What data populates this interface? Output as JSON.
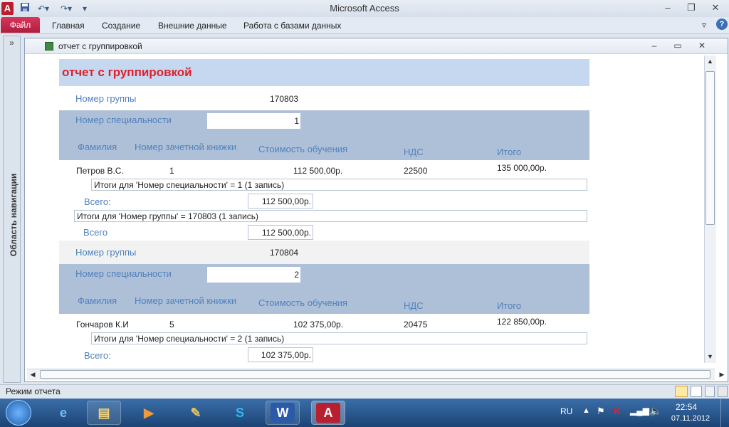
{
  "window": {
    "title": "Microsoft Access",
    "app_letter": "A",
    "minimize": "–",
    "maximize": "❐",
    "close": "✕"
  },
  "quick_access": {
    "save_icon": "save-icon",
    "undo_icon": "undo-icon",
    "redo_icon": "redo-icon",
    "customize_icon": "chevron-down-icon"
  },
  "ribbon": {
    "tabs": [
      "Файл",
      "Главная",
      "Создание",
      "Внешние данные",
      "Работа с базами данных"
    ]
  },
  "nav_pane": {
    "label": "Область навигации",
    "toggle": "»"
  },
  "document": {
    "title": "отчет с группировкой",
    "min": "–",
    "max": "▭",
    "close": "✕"
  },
  "report": {
    "title": "отчет с группировкой",
    "labels": {
      "group_no": "Номер группы",
      "spec_no": "Номер специальности",
      "surname": "Фамилия",
      "record_book": "Номер зачетной книжки",
      "cost": "Стоимость обучения",
      "vat": "НДС",
      "total": "Итого",
      "sum_short": "Всего:",
      "sum_group": "Всего"
    },
    "groups": [
      {
        "group_no": "170803",
        "spec_no": "1",
        "row": {
          "surname": "Петров В.С.",
          "record_book": "1",
          "cost": "112 500,00р.",
          "vat": "22500",
          "total": "135 000,00р."
        },
        "spec_summary": "Итоги для 'Номер специальности' =  1 (1 запись)",
        "spec_sum": "112 500,00р.",
        "group_summary": "Итоги для 'Номер группы' =  170803 (1 запись)",
        "group_sum": "112 500,00р."
      },
      {
        "group_no": "170804",
        "spec_no": "2",
        "row": {
          "surname": "Гончаров К.И",
          "record_book": "5",
          "cost": "102 375,00р.",
          "vat": "20475",
          "total": "122 850,00р."
        },
        "spec_summary": "Итоги для 'Номер специальности' =  2 (1 запись)",
        "spec_sum": "102 375,00р."
      }
    ]
  },
  "status": {
    "text": "Режим отчета"
  },
  "taskbar": {
    "lang": "RU",
    "time": "22:54",
    "date": "07.11.2012"
  },
  "colors": {
    "header_text": "#4f81bd",
    "title_text": "#e0202c",
    "band": "#aec0d8",
    "title_band": "#c6d8ef"
  }
}
